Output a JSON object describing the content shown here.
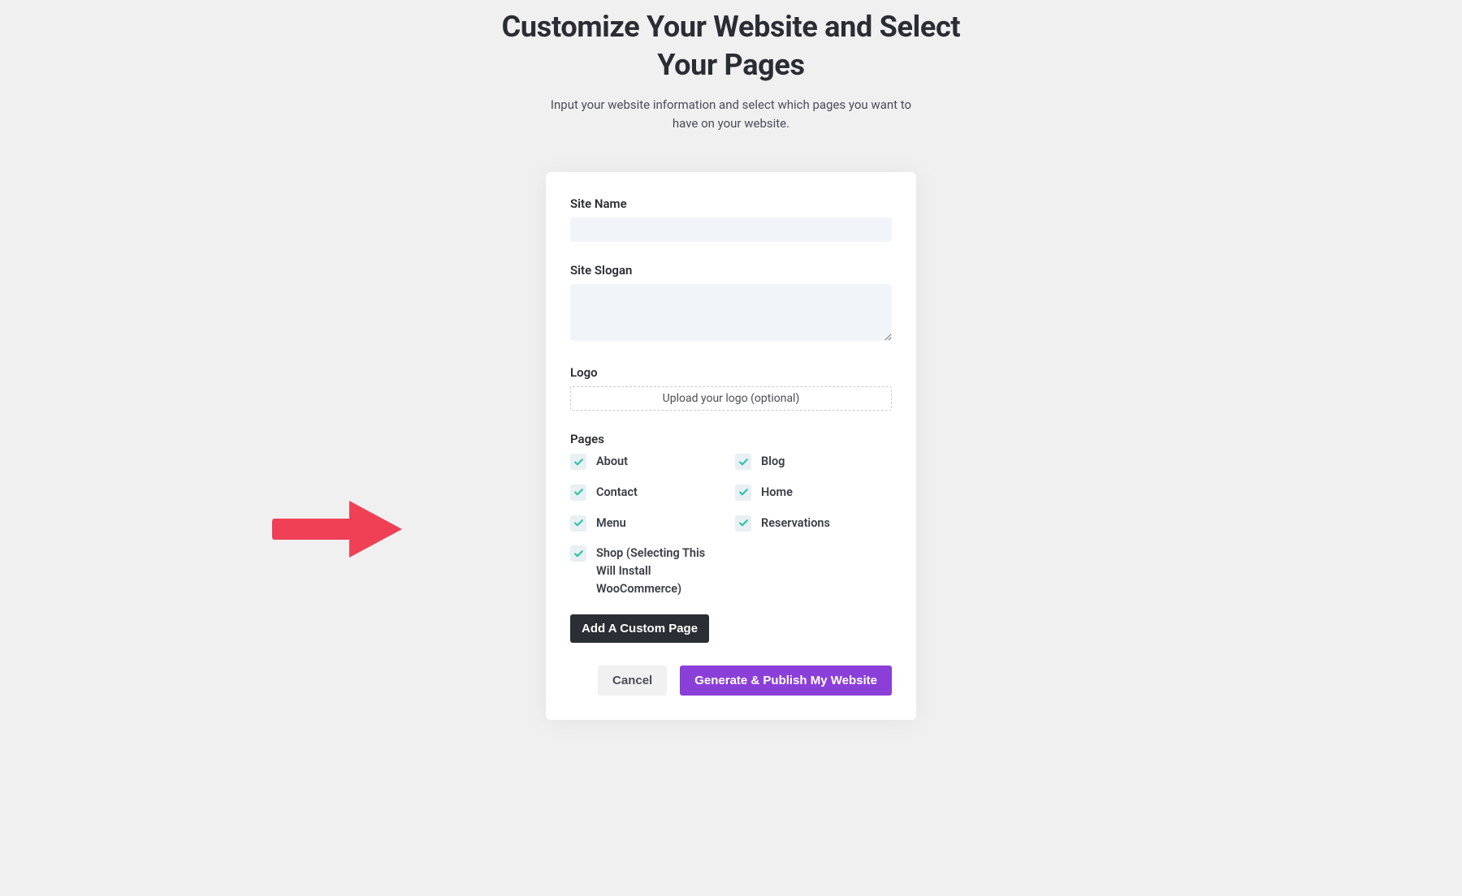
{
  "header": {
    "title": "Customize Your Website and Select Your Pages",
    "subtitle": "Input your website information and select which pages you want to have on your website."
  },
  "form": {
    "site_name": {
      "label": "Site Name",
      "value": ""
    },
    "site_slogan": {
      "label": "Site Slogan",
      "value": ""
    },
    "logo": {
      "label": "Logo",
      "upload_text": "Upload your logo (optional)"
    },
    "pages": {
      "label": "Pages",
      "items": [
        {
          "label": "About",
          "checked": true
        },
        {
          "label": "Blog",
          "checked": true
        },
        {
          "label": "Contact",
          "checked": true
        },
        {
          "label": "Home",
          "checked": true
        },
        {
          "label": "Menu",
          "checked": true
        },
        {
          "label": "Reservations",
          "checked": true
        },
        {
          "label": "Shop (Selecting This Will Install WooCommerce)",
          "checked": true
        }
      ],
      "add_button_label": "Add A Custom Page"
    },
    "buttons": {
      "cancel": "Cancel",
      "generate": "Generate & Publish My Website"
    }
  },
  "colors": {
    "accent_purple": "#8b3fd9",
    "check_teal": "#2bc4a8",
    "arrow_red": "#ef4056"
  }
}
